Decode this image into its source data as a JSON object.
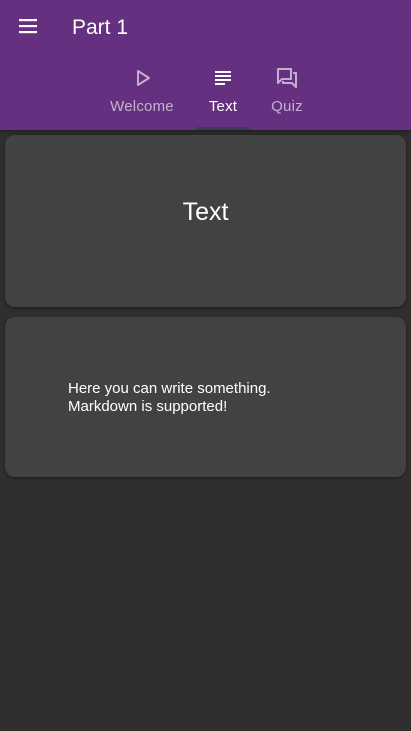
{
  "app_bar": {
    "title": "Part 1",
    "menu_icon": "menu-icon"
  },
  "tabs": [
    {
      "label": "Welcome",
      "icon": "play-icon",
      "active": false
    },
    {
      "label": "Text",
      "icon": "text-lines-icon",
      "active": true
    },
    {
      "label": "Quiz",
      "icon": "forum-icon",
      "active": false
    }
  ],
  "content": {
    "heading": "Text",
    "body_line1": "Here you can write something.",
    "body_line2": "Markdown is supported!"
  },
  "colors": {
    "app_bar": "#65307f",
    "background": "#2f2f2f",
    "card": "#424242"
  }
}
